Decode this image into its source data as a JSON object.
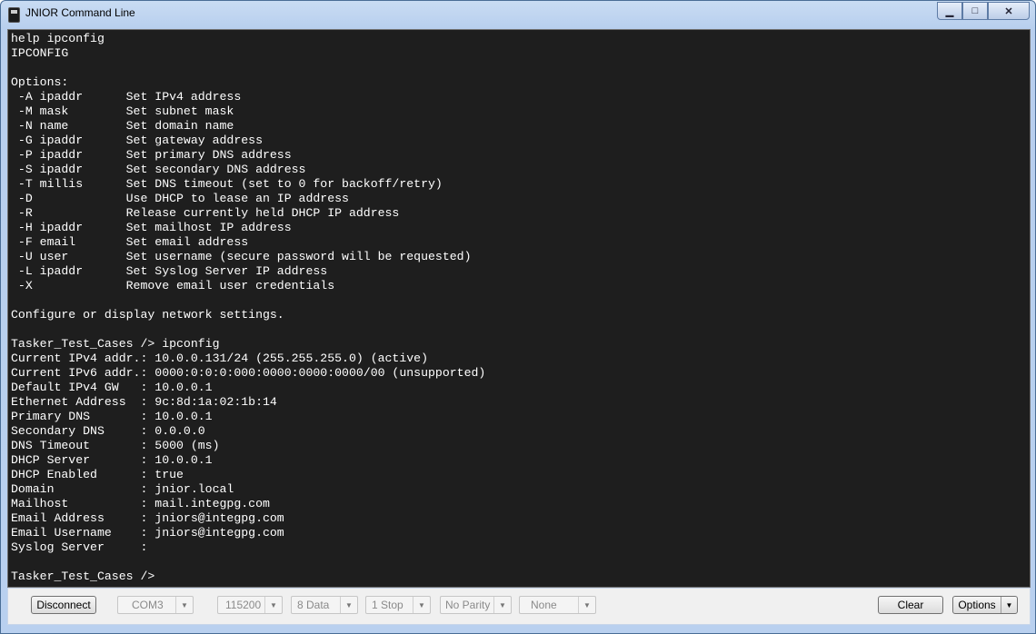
{
  "window": {
    "title": "JNIOR Command Line",
    "icon": "jnior-device-icon"
  },
  "caption_buttons": {
    "minimize": "▁",
    "maximize": "□",
    "close": "✕"
  },
  "terminal": {
    "lines": [
      "help ipconfig",
      "IPCONFIG",
      "",
      "Options:",
      " -A ipaddr      Set IPv4 address",
      " -M mask        Set subnet mask",
      " -N name        Set domain name",
      " -G ipaddr      Set gateway address",
      " -P ipaddr      Set primary DNS address",
      " -S ipaddr      Set secondary DNS address",
      " -T millis      Set DNS timeout (set to 0 for backoff/retry)",
      " -D             Use DHCP to lease an IP address",
      " -R             Release currently held DHCP IP address",
      " -H ipaddr      Set mailhost IP address",
      " -F email       Set email address",
      " -U user        Set username (secure password will be requested)",
      " -L ipaddr      Set Syslog Server IP address",
      " -X             Remove email user credentials",
      "",
      "Configure or display network settings.",
      "",
      "Tasker_Test_Cases /> ipconfig",
      "Current IPv4 addr.: 10.0.0.131/24 (255.255.255.0) (active)",
      "Current IPv6 addr.: 0000:0:0:0:000:0000:0000:0000/00 (unsupported)",
      "Default IPv4 GW   : 10.0.0.1",
      "Ethernet Address  : 9c:8d:1a:02:1b:14",
      "Primary DNS       : 10.0.0.1",
      "Secondary DNS     : 0.0.0.0",
      "DNS Timeout       : 5000 (ms)",
      "DHCP Server       : 10.0.0.1",
      "DHCP Enabled      : true",
      "Domain            : jnior.local",
      "Mailhost          : mail.integpg.com",
      "Email Address     : jniors@integpg.com",
      "Email Username    : jniors@integpg.com",
      "Syslog Server     :",
      "",
      "Tasker_Test_Cases />"
    ]
  },
  "statusbar": {
    "disconnect_label": "Disconnect",
    "port": "COM3",
    "baud": "115200",
    "data_bits": "8 Data",
    "stop_bits": "1 Stop",
    "parity": "No Parity",
    "flow": "None",
    "clear_label": "Clear",
    "options_label": "Options"
  }
}
